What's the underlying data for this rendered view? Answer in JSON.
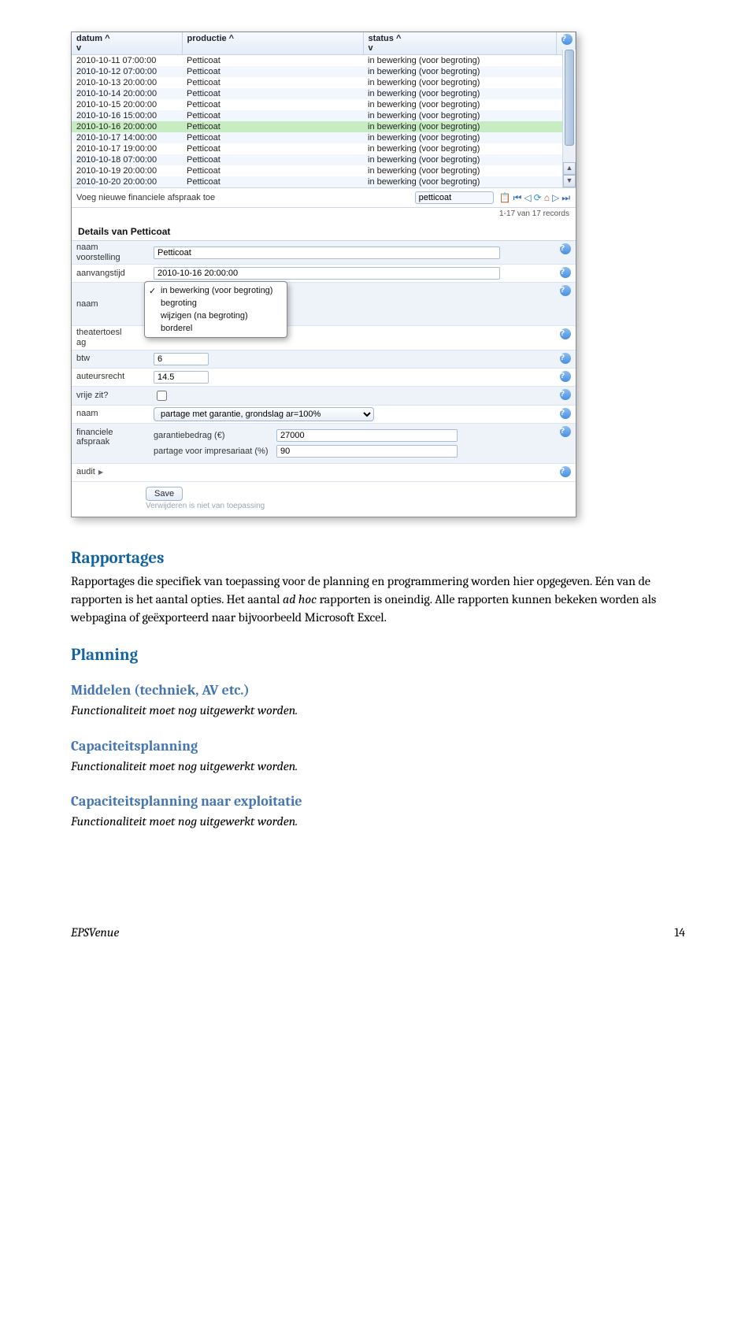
{
  "screenshot": {
    "columns": {
      "datum": "datum",
      "productie": "productie",
      "status": "status",
      "sort": "^\nv"
    },
    "rows": [
      {
        "datum": "2010-10-11 07:00:00",
        "productie": "Petticoat",
        "status": "in bewerking (voor begroting)"
      },
      {
        "datum": "2010-10-12 07:00:00",
        "productie": "Petticoat",
        "status": "in bewerking (voor begroting)"
      },
      {
        "datum": "2010-10-13 20:00:00",
        "productie": "Petticoat",
        "status": "in bewerking (voor begroting)"
      },
      {
        "datum": "2010-10-14 20:00:00",
        "productie": "Petticoat",
        "status": "in bewerking (voor begroting)"
      },
      {
        "datum": "2010-10-15 20:00:00",
        "productie": "Petticoat",
        "status": "in bewerking (voor begroting)"
      },
      {
        "datum": "2010-10-16 15:00:00",
        "productie": "Petticoat",
        "status": "in bewerking (voor begroting)"
      },
      {
        "datum": "2010-10-16 20:00:00",
        "productie": "Petticoat",
        "status": "in bewerking (voor begroting)",
        "selected": true
      },
      {
        "datum": "2010-10-17 14:00:00",
        "productie": "Petticoat",
        "status": "in bewerking (voor begroting)"
      },
      {
        "datum": "2010-10-17 19:00:00",
        "productie": "Petticoat",
        "status": "in bewerking (voor begroting)"
      },
      {
        "datum": "2010-10-18 07:00:00",
        "productie": "Petticoat",
        "status": "in bewerking (voor begroting)"
      },
      {
        "datum": "2010-10-19 20:00:00",
        "productie": "Petticoat",
        "status": "in bewerking (voor begroting)"
      },
      {
        "datum": "2010-10-20 20:00:00",
        "productie": "Petticoat",
        "status": "in bewerking (voor begroting)"
      }
    ],
    "add_label": "Voeg nieuwe financiele afspraak toe",
    "search_value": "petticoat",
    "record_count": "1-17 van 17 records",
    "detail_title": "Details van Petticoat",
    "form": {
      "naam_voorstelling_label": "naam\nvoorstelling",
      "naam_voorstelling_value": "Petticoat",
      "aanvangstijd_label": "aanvangstijd",
      "aanvangstijd_value": "2010-10-16 20:00:00",
      "naam_label": "naam",
      "status_options": [
        "in bewerking (voor begroting)",
        "begroting",
        "wijzigen (na begroting)",
        "borderel"
      ],
      "status_selected": "in bewerking (voor begroting)",
      "theatertoes_label": "theatertoesl\nag",
      "btw_label": "btw",
      "btw_value": "6",
      "auteursrecht_label": "auteursrecht",
      "auteursrecht_value": "14.5",
      "vrijezit_label": "vrije zit?",
      "naam2_label": "naam",
      "naam2_value": "partage met garantie, grondslag ar=100%",
      "fin_label": "financiele\nafspraak",
      "garantiebedrag_label": "garantiebedrag (€)",
      "garantiebedrag_value": "27000",
      "partage_label": "partage voor impresariaat (%)",
      "partage_value": "90",
      "audit_label": "audit",
      "save_label": "Save",
      "delete_note": "Verwijderen is niet van toepassing"
    }
  },
  "doc": {
    "rapportages_h": "Rapportages",
    "rapportages_p": "Rapportages die specifiek van toepassing voor de planning en programmering worden hier opgegeven. Eén van de rapporten is het aantal opties. Het aantal ",
    "rapportages_em": "ad hoc",
    "rapportages_p2": " rapporten is oneindig. Alle rapporten kunnen bekeken worden als webpagina of geëxporteerd naar bijvoorbeeld Microsoft Excel.",
    "planning_h": "Planning",
    "middelen_h": "Middelen (techniek, AV etc.)",
    "todo": "Functionaliteit moet nog uitgewerkt worden.",
    "cap_h": "Capaciteitsplanning",
    "capexp_h": "Capaciteitsplanning naar exploitatie",
    "footer_brand": "EPSVenue",
    "footer_page": "14"
  }
}
